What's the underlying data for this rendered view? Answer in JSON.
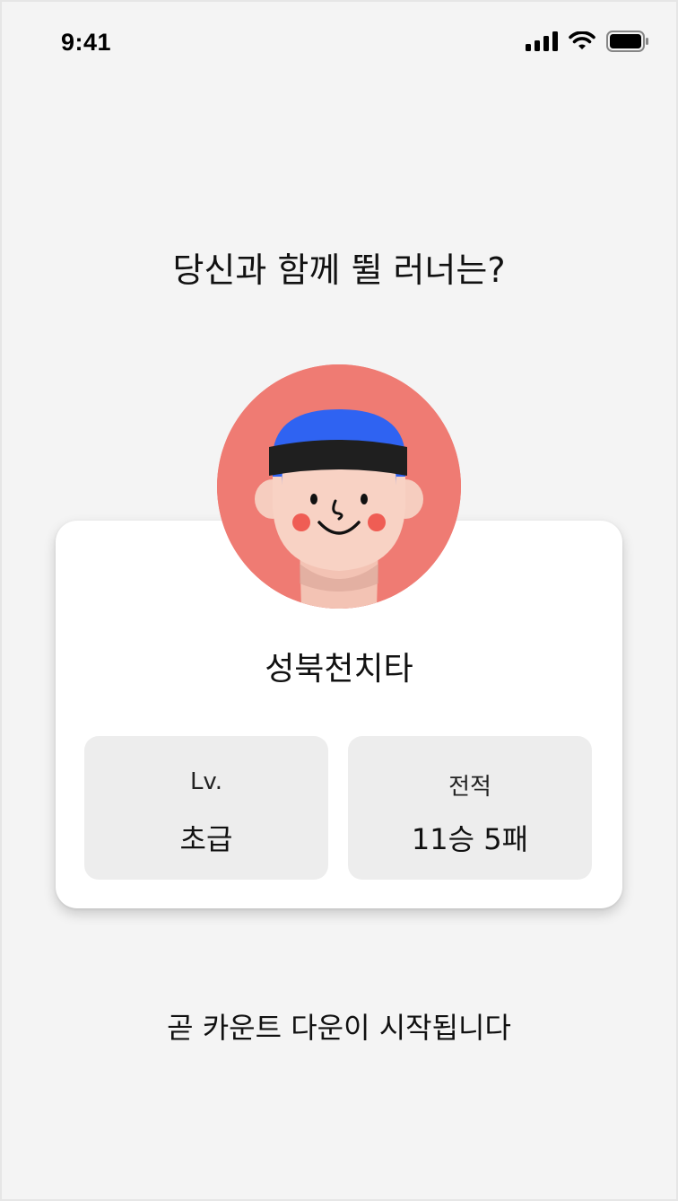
{
  "status_bar": {
    "time": "9:41",
    "icons": [
      "signal-icon",
      "wifi-icon",
      "battery-icon"
    ]
  },
  "headline": "당신과 함께 뛸 러너는?",
  "runner": {
    "avatar": "runner-avatar",
    "name": "성북천치타",
    "stats": {
      "level_label": "Lv.",
      "level_value": "초급",
      "record_label": "전적",
      "record_value": "11승 5패"
    }
  },
  "countdown_message": "곧 카운트 다운이 시작됩니다",
  "colors": {
    "background": "#f4f4f4",
    "avatar_bg": "#ef7b73",
    "headband": "#2f63f2",
    "stat_box": "#ededed"
  }
}
